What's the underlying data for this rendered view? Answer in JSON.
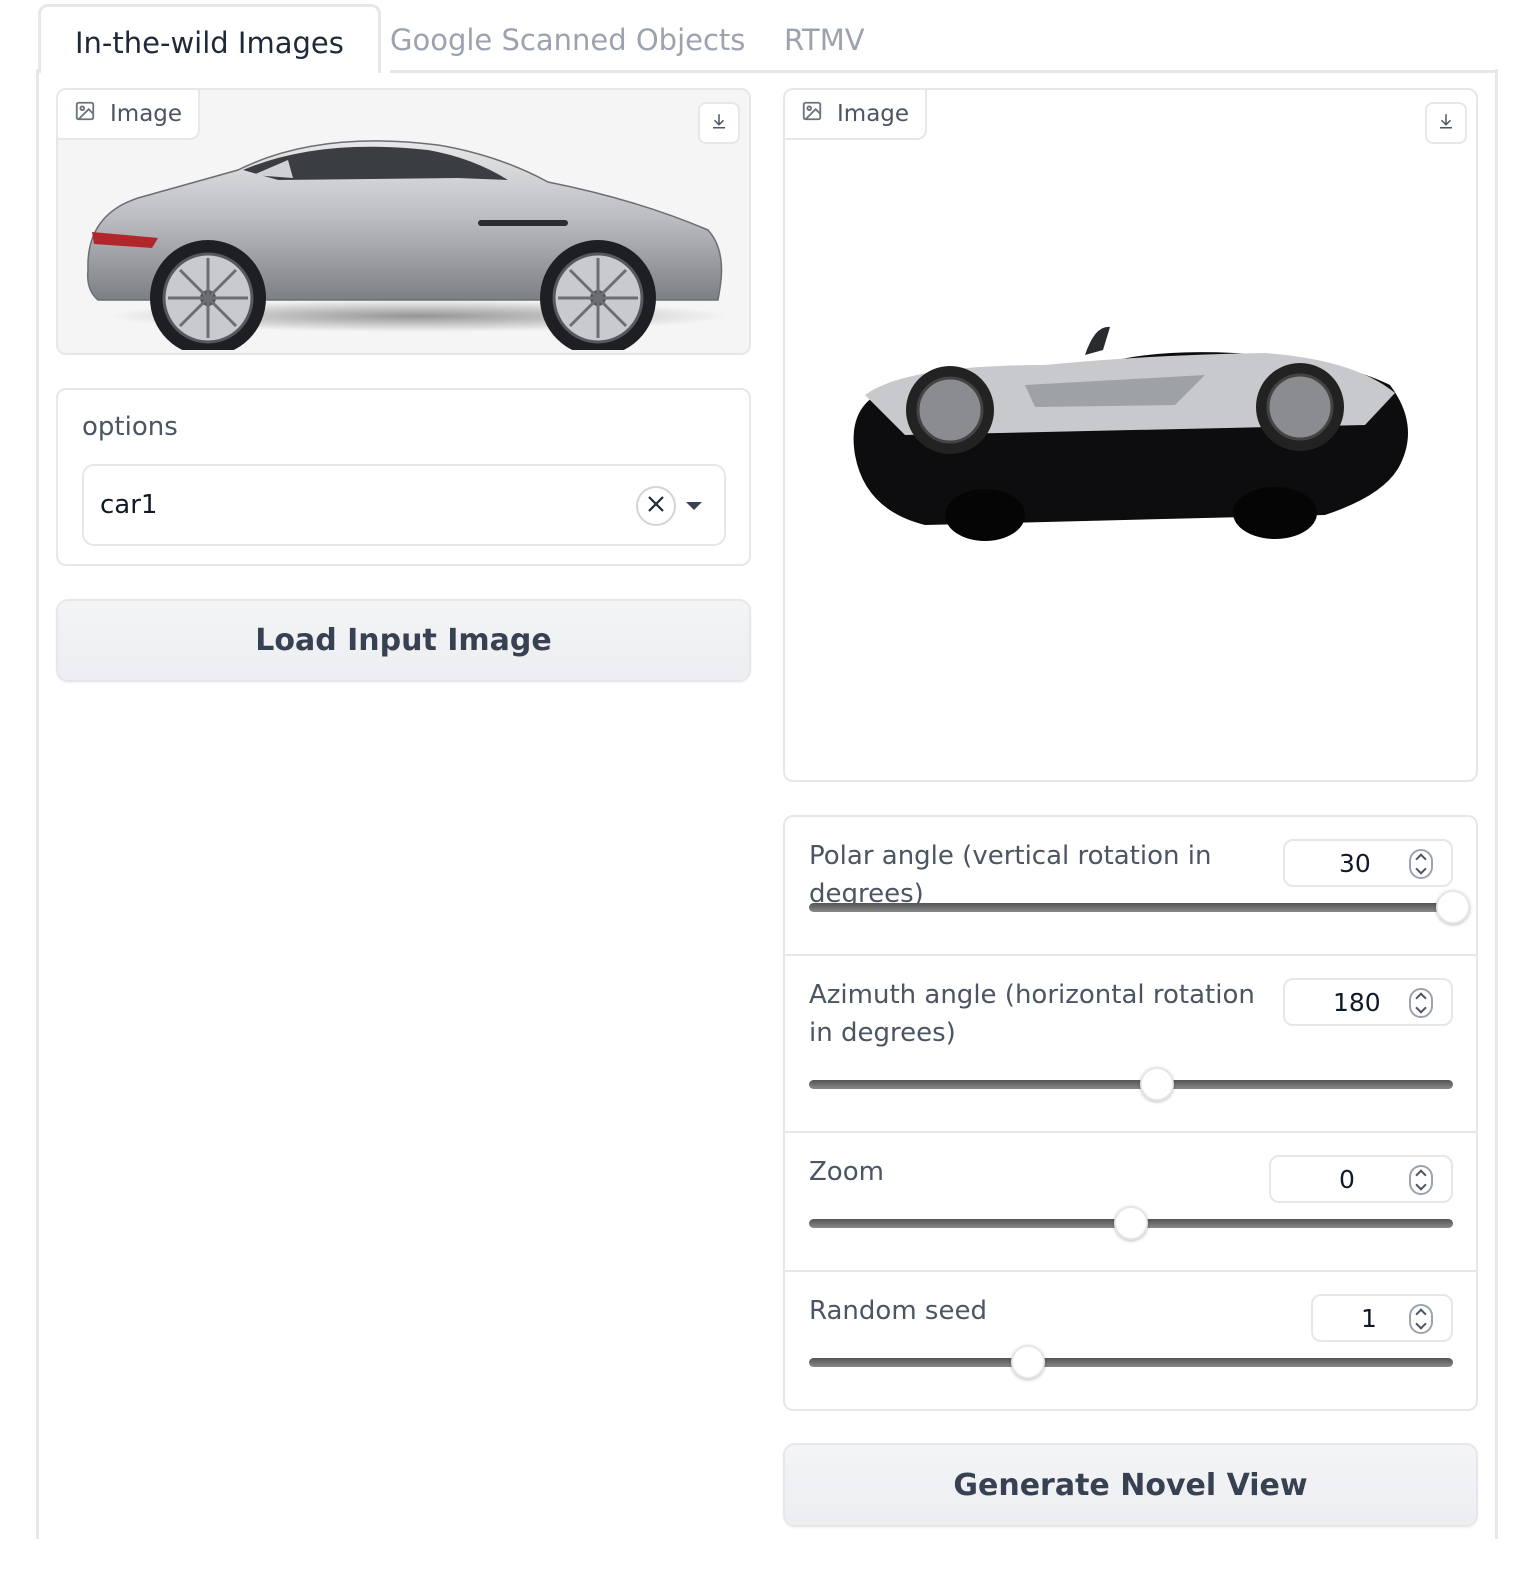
{
  "tabs": [
    {
      "label": "In-the-wild Images",
      "active": true
    },
    {
      "label": "Google Scanned Objects",
      "active": false
    },
    {
      "label": "RTMV",
      "active": false
    }
  ],
  "input_image": {
    "label": "Image",
    "icon": "image-icon",
    "download_icon": "download-icon"
  },
  "output_image": {
    "label": "Image",
    "icon": "image-icon",
    "download_icon": "download-icon"
  },
  "options": {
    "label": "options",
    "value": "car1"
  },
  "load_button": "Load Input Image",
  "sliders": [
    {
      "label": "Polar angle (vertical rotation in degrees)",
      "value": "30",
      "fraction": 1.0
    },
    {
      "label": "Azimuth angle (horizontal rotation in degrees)",
      "value": "180",
      "fraction": 0.54
    },
    {
      "label": "Zoom",
      "value": "0",
      "fraction": 0.5
    },
    {
      "label": "Random seed",
      "value": "1",
      "fraction": 0.34
    }
  ],
  "generate_button": "Generate Novel View"
}
